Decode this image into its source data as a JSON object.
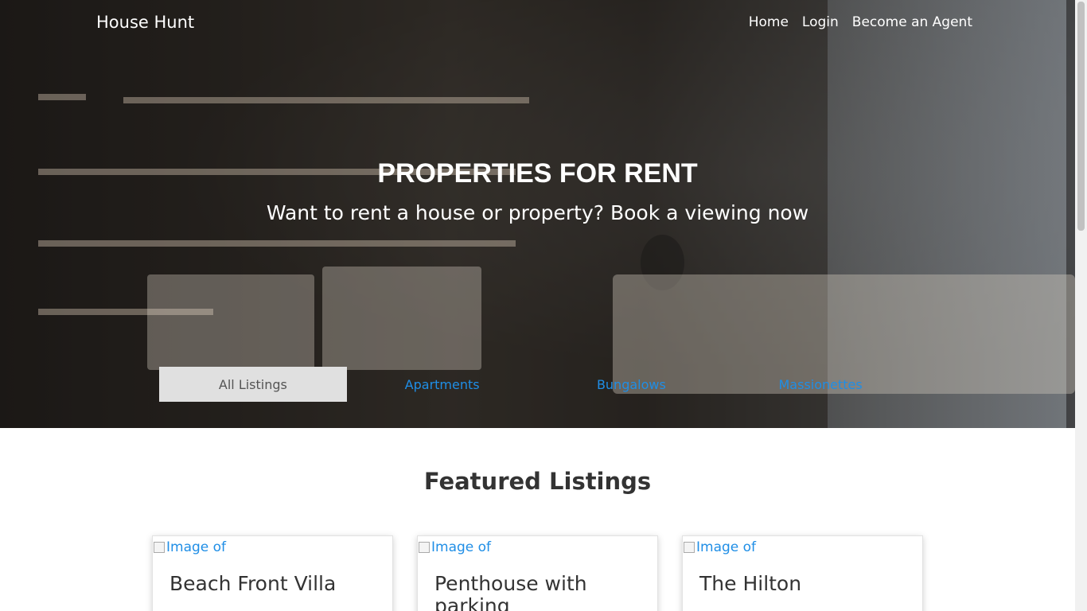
{
  "nav": {
    "brand": "House Hunt",
    "links": [
      "Home",
      "Login",
      "Become an Agent"
    ]
  },
  "hero": {
    "title": "PROPERTIES FOR RENT",
    "subtitle": "Want to rent a house or property? Book a viewing now"
  },
  "tabs": {
    "items": [
      "All Listings",
      "Apartments",
      "Bungalows",
      "Massionettes"
    ],
    "active": "All Listings"
  },
  "featured": {
    "title": "Featured Listings",
    "cards": [
      {
        "image_alt": "Image of",
        "title": "Beach Front Villa"
      },
      {
        "image_alt": "Image of",
        "title": "Penthouse with parking"
      },
      {
        "image_alt": "Image of",
        "title": "The Hilton"
      }
    ]
  },
  "colors": {
    "link": "#1f8ee6",
    "active_tab_bg": "#e0e0e0",
    "hero_text": "#ffffff"
  }
}
